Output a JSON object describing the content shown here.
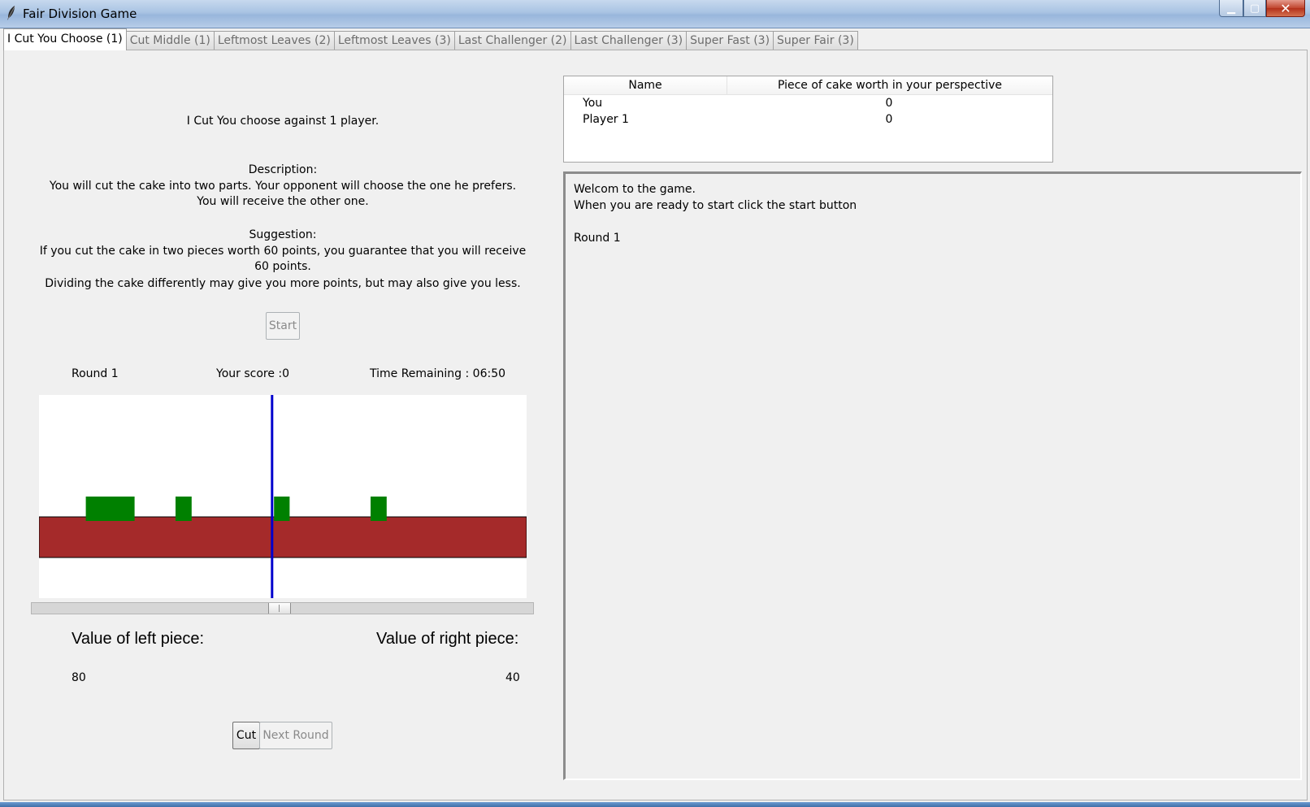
{
  "window": {
    "title": "Fair Division Game",
    "minimize_glyph": "▁",
    "maximize_glyph": "▢",
    "close_glyph": "✕"
  },
  "tabs": [
    {
      "label": "I Cut You Choose (1)",
      "active": true
    },
    {
      "label": "Cut Middle (1)",
      "active": false
    },
    {
      "label": "Leftmost Leaves (2)",
      "active": false
    },
    {
      "label": "Leftmost Leaves (3)",
      "active": false
    },
    {
      "label": "Last Challenger (2)",
      "active": false
    },
    {
      "label": "Last Challenger (3)",
      "active": false
    },
    {
      "label": "Super Fast (3)",
      "active": false
    },
    {
      "label": "Super Fair (3)",
      "active": false
    }
  ],
  "intro": {
    "heading": "I Cut You choose against 1 player.",
    "description_title": "Description:",
    "description_text": "You will cut the cake into two parts. Your opponent will choose the one he prefers. You will receive the other one.",
    "suggestion_title": "Suggestion:",
    "suggestion_text": "If you cut the cake in two pieces worth 60 points, you guarantee that you will receive 60 points.",
    "suggestion_text2": "Dividing the cake differently may give you more points, but may also give you less."
  },
  "start_button": "Start",
  "status": {
    "round": "Round 1",
    "score": "Your score :0",
    "time": "Time Remaining : 06:50"
  },
  "cake": {
    "cut_position": 0.478,
    "colors": {
      "cake": "#a52a2a",
      "topping": "#008000",
      "cut_line": "#0000cd",
      "cake_border": "#000000"
    },
    "toppings": [
      {
        "start": 0.096,
        "end": 0.196
      },
      {
        "start": 0.28,
        "end": 0.313
      },
      {
        "start": 0.482,
        "end": 0.514
      },
      {
        "start": 0.68,
        "end": 0.713
      }
    ]
  },
  "slider": {
    "value": 0.478
  },
  "pieces": {
    "left_label": "Value of left piece:",
    "left_value": "80",
    "right_label": "Value of right piece:",
    "right_value": "40"
  },
  "actions": {
    "cut_label": "Cut",
    "next_round_label": "Next Round"
  },
  "scoreboard": {
    "col_name": "Name",
    "col_worth": "Piece of cake worth in your perspective",
    "rows": [
      {
        "name": "You",
        "worth": "0"
      },
      {
        "name": "Player 1",
        "worth": "0"
      }
    ]
  },
  "log": {
    "lines": [
      "Welcom to the game.",
      "When you are ready to start click the start button",
      "",
      "Round 1"
    ]
  }
}
